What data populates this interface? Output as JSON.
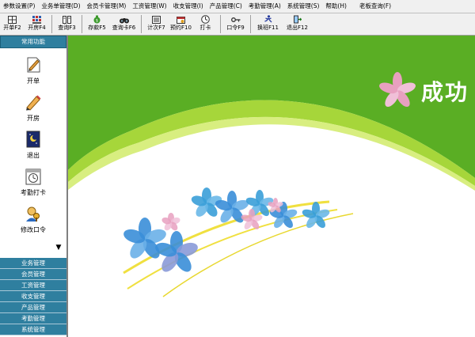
{
  "menu": [
    "参数设置(P)",
    "业务单管理(D)",
    "会员卡管理(M)",
    "工资管理(W)",
    "收支管理(I)",
    "产品管理(C)",
    "考勤管理(A)",
    "系统管理(S)",
    "帮助(H)",
    "老板查询(F)"
  ],
  "toolbar": [
    {
      "label": "开单F2",
      "icon": "grid-icon"
    },
    {
      "label": "开房F4",
      "icon": "room-grid-icon"
    },
    {
      "label": "查询F3",
      "icon": "query-icon"
    },
    {
      "label": "存款F5",
      "icon": "money-bag-icon"
    },
    {
      "label": "查询卡F6",
      "icon": "binoculars-icon"
    },
    {
      "label": "计次F7",
      "icon": "count-icon"
    },
    {
      "label": "预约F10",
      "icon": "reserve-icon"
    },
    {
      "label": "打卡",
      "icon": "clock-icon"
    },
    {
      "label": "口令F9",
      "icon": "key-icon"
    },
    {
      "label": "换班F11",
      "icon": "runner-icon"
    },
    {
      "label": "退出F12",
      "icon": "exit-door-icon"
    }
  ],
  "sidebar": {
    "header": "常用功能",
    "tools": [
      {
        "label": "开单",
        "icon": "order-icon"
      },
      {
        "label": "开房",
        "icon": "pencil-icon"
      },
      {
        "label": "退出",
        "icon": "exit-night-icon"
      },
      {
        "label": "考勤打卡",
        "icon": "timecard-icon"
      },
      {
        "label": "修改口令",
        "icon": "password-user-icon"
      }
    ],
    "groups": [
      "业务管理",
      "会员管理",
      "工资管理",
      "收支管理",
      "产品管理",
      "考勤管理",
      "系统管理"
    ]
  },
  "banner": {
    "title": "成功"
  },
  "colors": {
    "menu_bg": "#f0f0f0",
    "sidebar_header": "#2f7f9f",
    "banner_green": "#5aae24",
    "banner_light": "#a6d63a"
  }
}
